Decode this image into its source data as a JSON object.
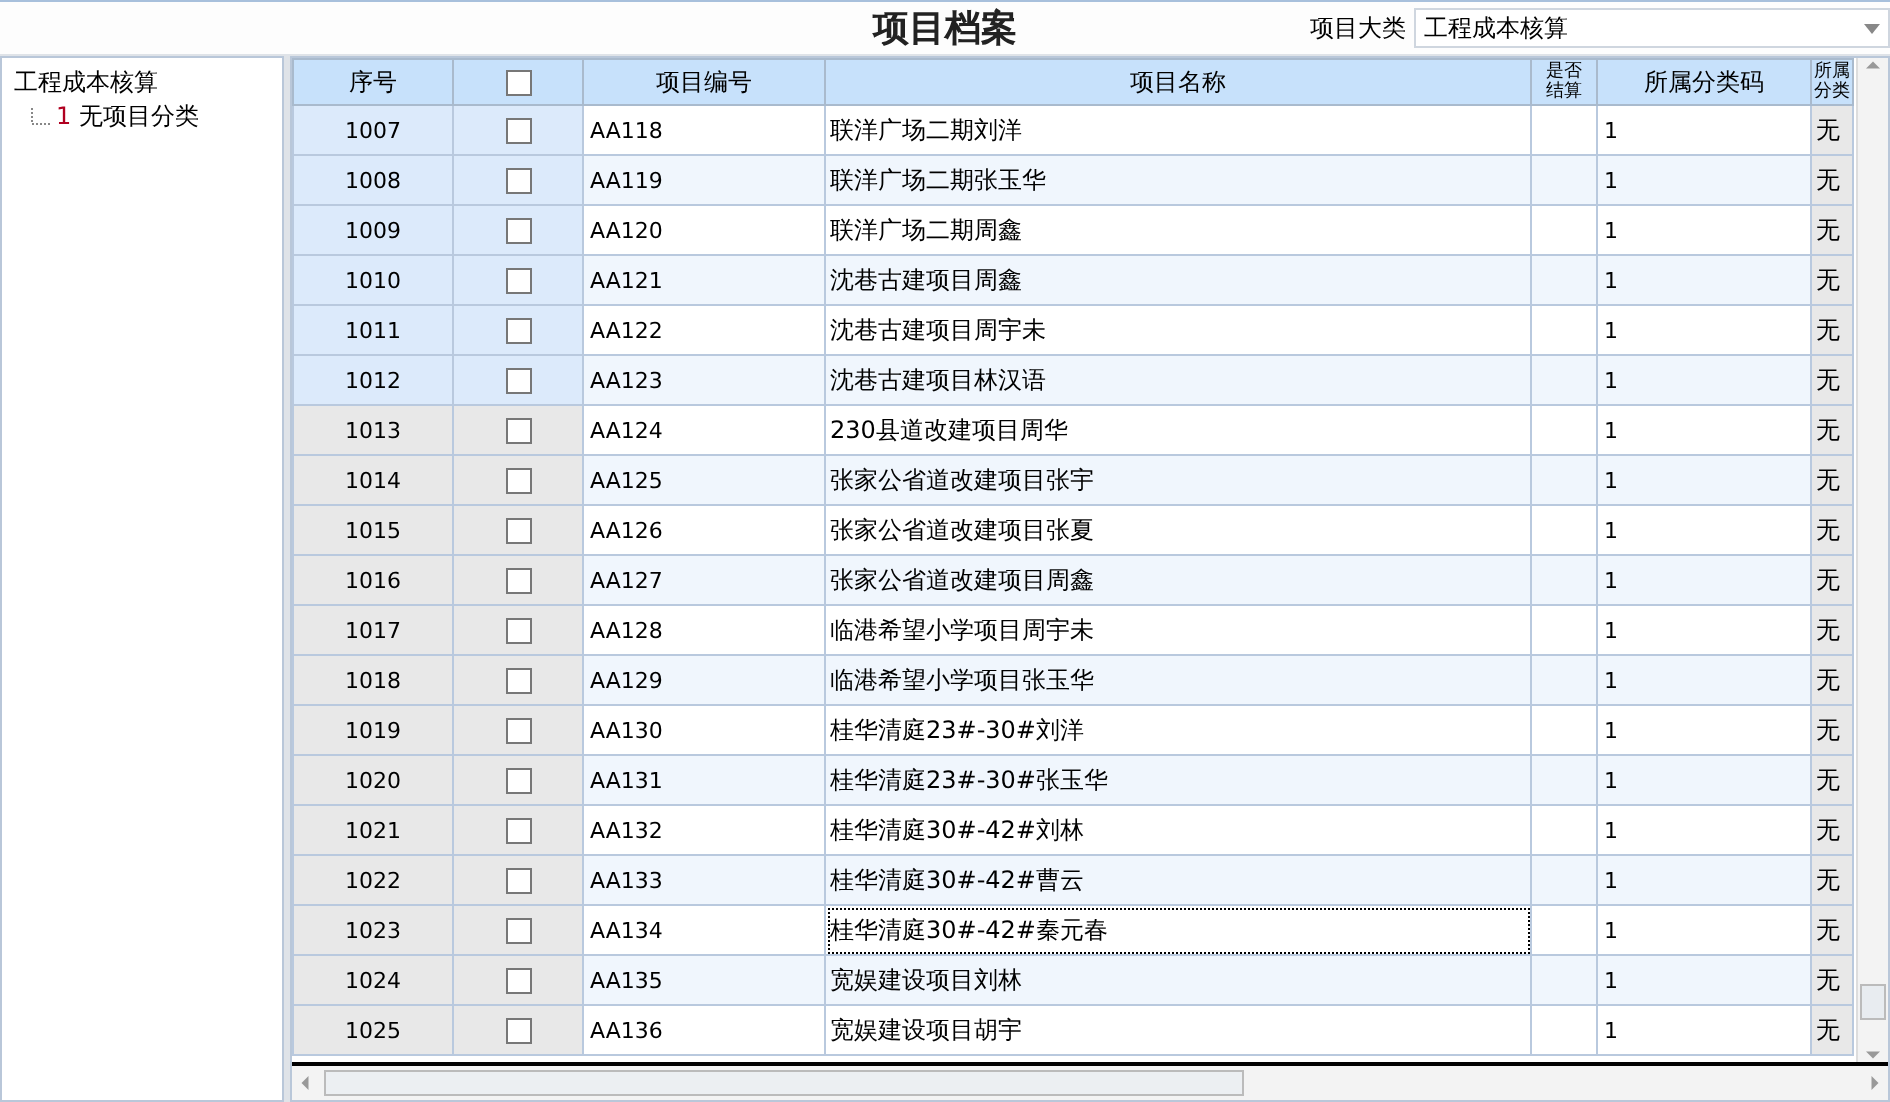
{
  "title": "项目档案",
  "category": {
    "label": "项目大类",
    "value": "工程成本核算"
  },
  "tree": {
    "label": "工程成本核算",
    "children": [
      {
        "code": "1",
        "label": "无项目分类"
      }
    ]
  },
  "table": {
    "columns": [
      "序号",
      "",
      "项目编号",
      "项目名称",
      "是否结算",
      "所属分类码",
      "所属分类"
    ],
    "header_checked": false,
    "rows": [
      {
        "no": "1007",
        "checked": false,
        "code": "AA118",
        "name": "联洋广场二期刘洋",
        "class_code": "1",
        "class": "无",
        "selected": true,
        "focused": false
      },
      {
        "no": "1008",
        "checked": false,
        "code": "AA119",
        "name": "联洋广场二期张玉华",
        "class_code": "1",
        "class": "无",
        "selected": true,
        "focused": false
      },
      {
        "no": "1009",
        "checked": false,
        "code": "AA120",
        "name": "联洋广场二期周鑫",
        "class_code": "1",
        "class": "无",
        "selected": true,
        "focused": false
      },
      {
        "no": "1010",
        "checked": false,
        "code": "AA121",
        "name": "沈巷古建项目周鑫",
        "class_code": "1",
        "class": "无",
        "selected": true,
        "focused": false
      },
      {
        "no": "1011",
        "checked": false,
        "code": "AA122",
        "name": "沈巷古建项目周宇未",
        "class_code": "1",
        "class": "无",
        "selected": true,
        "focused": false
      },
      {
        "no": "1012",
        "checked": false,
        "code": "AA123",
        "name": "沈巷古建项目林汉语",
        "class_code": "1",
        "class": "无",
        "selected": true,
        "focused": false
      },
      {
        "no": "1013",
        "checked": false,
        "code": "AA124",
        "name": "230县道改建项目周华",
        "class_code": "1",
        "class": "无",
        "selected": false,
        "focused": false
      },
      {
        "no": "1014",
        "checked": false,
        "code": "AA125",
        "name": "张家公省道改建项目张宇",
        "class_code": "1",
        "class": "无",
        "selected": false,
        "focused": false
      },
      {
        "no": "1015",
        "checked": false,
        "code": "AA126",
        "name": "张家公省道改建项目张夏",
        "class_code": "1",
        "class": "无",
        "selected": false,
        "focused": false
      },
      {
        "no": "1016",
        "checked": false,
        "code": "AA127",
        "name": "张家公省道改建项目周鑫",
        "class_code": "1",
        "class": "无",
        "selected": false,
        "focused": false
      },
      {
        "no": "1017",
        "checked": false,
        "code": "AA128",
        "name": "临港希望小学项目周宇未",
        "class_code": "1",
        "class": "无",
        "selected": false,
        "focused": false
      },
      {
        "no": "1018",
        "checked": false,
        "code": "AA129",
        "name": "临港希望小学项目张玉华",
        "class_code": "1",
        "class": "无",
        "selected": false,
        "focused": false
      },
      {
        "no": "1019",
        "checked": false,
        "code": "AA130",
        "name": "桂华清庭23#-30#刘洋",
        "class_code": "1",
        "class": "无",
        "selected": false,
        "focused": false
      },
      {
        "no": "1020",
        "checked": false,
        "code": "AA131",
        "name": "桂华清庭23#-30#张玉华",
        "class_code": "1",
        "class": "无",
        "selected": false,
        "focused": false
      },
      {
        "no": "1021",
        "checked": false,
        "code": "AA132",
        "name": "桂华清庭30#-42#刘林",
        "class_code": "1",
        "class": "无",
        "selected": false,
        "focused": false
      },
      {
        "no": "1022",
        "checked": false,
        "code": "AA133",
        "name": "桂华清庭30#-42#曹云",
        "class_code": "1",
        "class": "无",
        "selected": false,
        "focused": false
      },
      {
        "no": "1023",
        "checked": false,
        "code": "AA134",
        "name": "桂华清庭30#-42#秦元春",
        "class_code": "1",
        "class": "无",
        "selected": false,
        "focused": true
      },
      {
        "no": "1024",
        "checked": false,
        "code": "AA135",
        "name": "宽娱建设项目刘林",
        "class_code": "1",
        "class": "无",
        "selected": false,
        "focused": false
      },
      {
        "no": "1025",
        "checked": false,
        "code": "AA136",
        "name": "宽娱建设项目胡宇",
        "class_code": "1",
        "class": "无",
        "selected": false,
        "focused": false
      }
    ]
  }
}
